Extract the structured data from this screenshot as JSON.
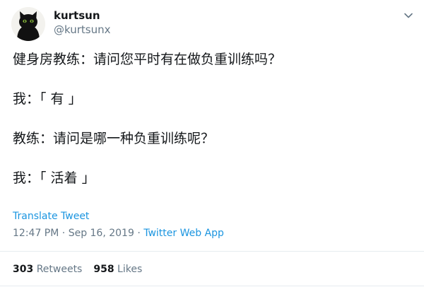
{
  "user": {
    "display_name": "kurtsun",
    "handle": "@kurtsunx",
    "avatar_icon": "black-cat-avatar-icon"
  },
  "menu_icon": "chevron-down-icon",
  "tweet": {
    "lines": [
      "健身房教练：请问您平时有在做负重训练吗？",
      "我：「 有 」",
      "教练：请问是哪一种负重训练呢？",
      "我：「 活着 」"
    ],
    "translate_label": "Translate Tweet",
    "time": "12:47 PM",
    "separator": "·",
    "date": "Sep 16, 2019",
    "source": "Twitter Web App"
  },
  "stats": {
    "retweets_count": "303",
    "retweets_label": "Retweets",
    "likes_count": "958",
    "likes_label": "Likes"
  },
  "colors": {
    "link": "#1b95e0",
    "muted": "#657786",
    "text": "#14171a",
    "divider": "#e6ecf0"
  }
}
